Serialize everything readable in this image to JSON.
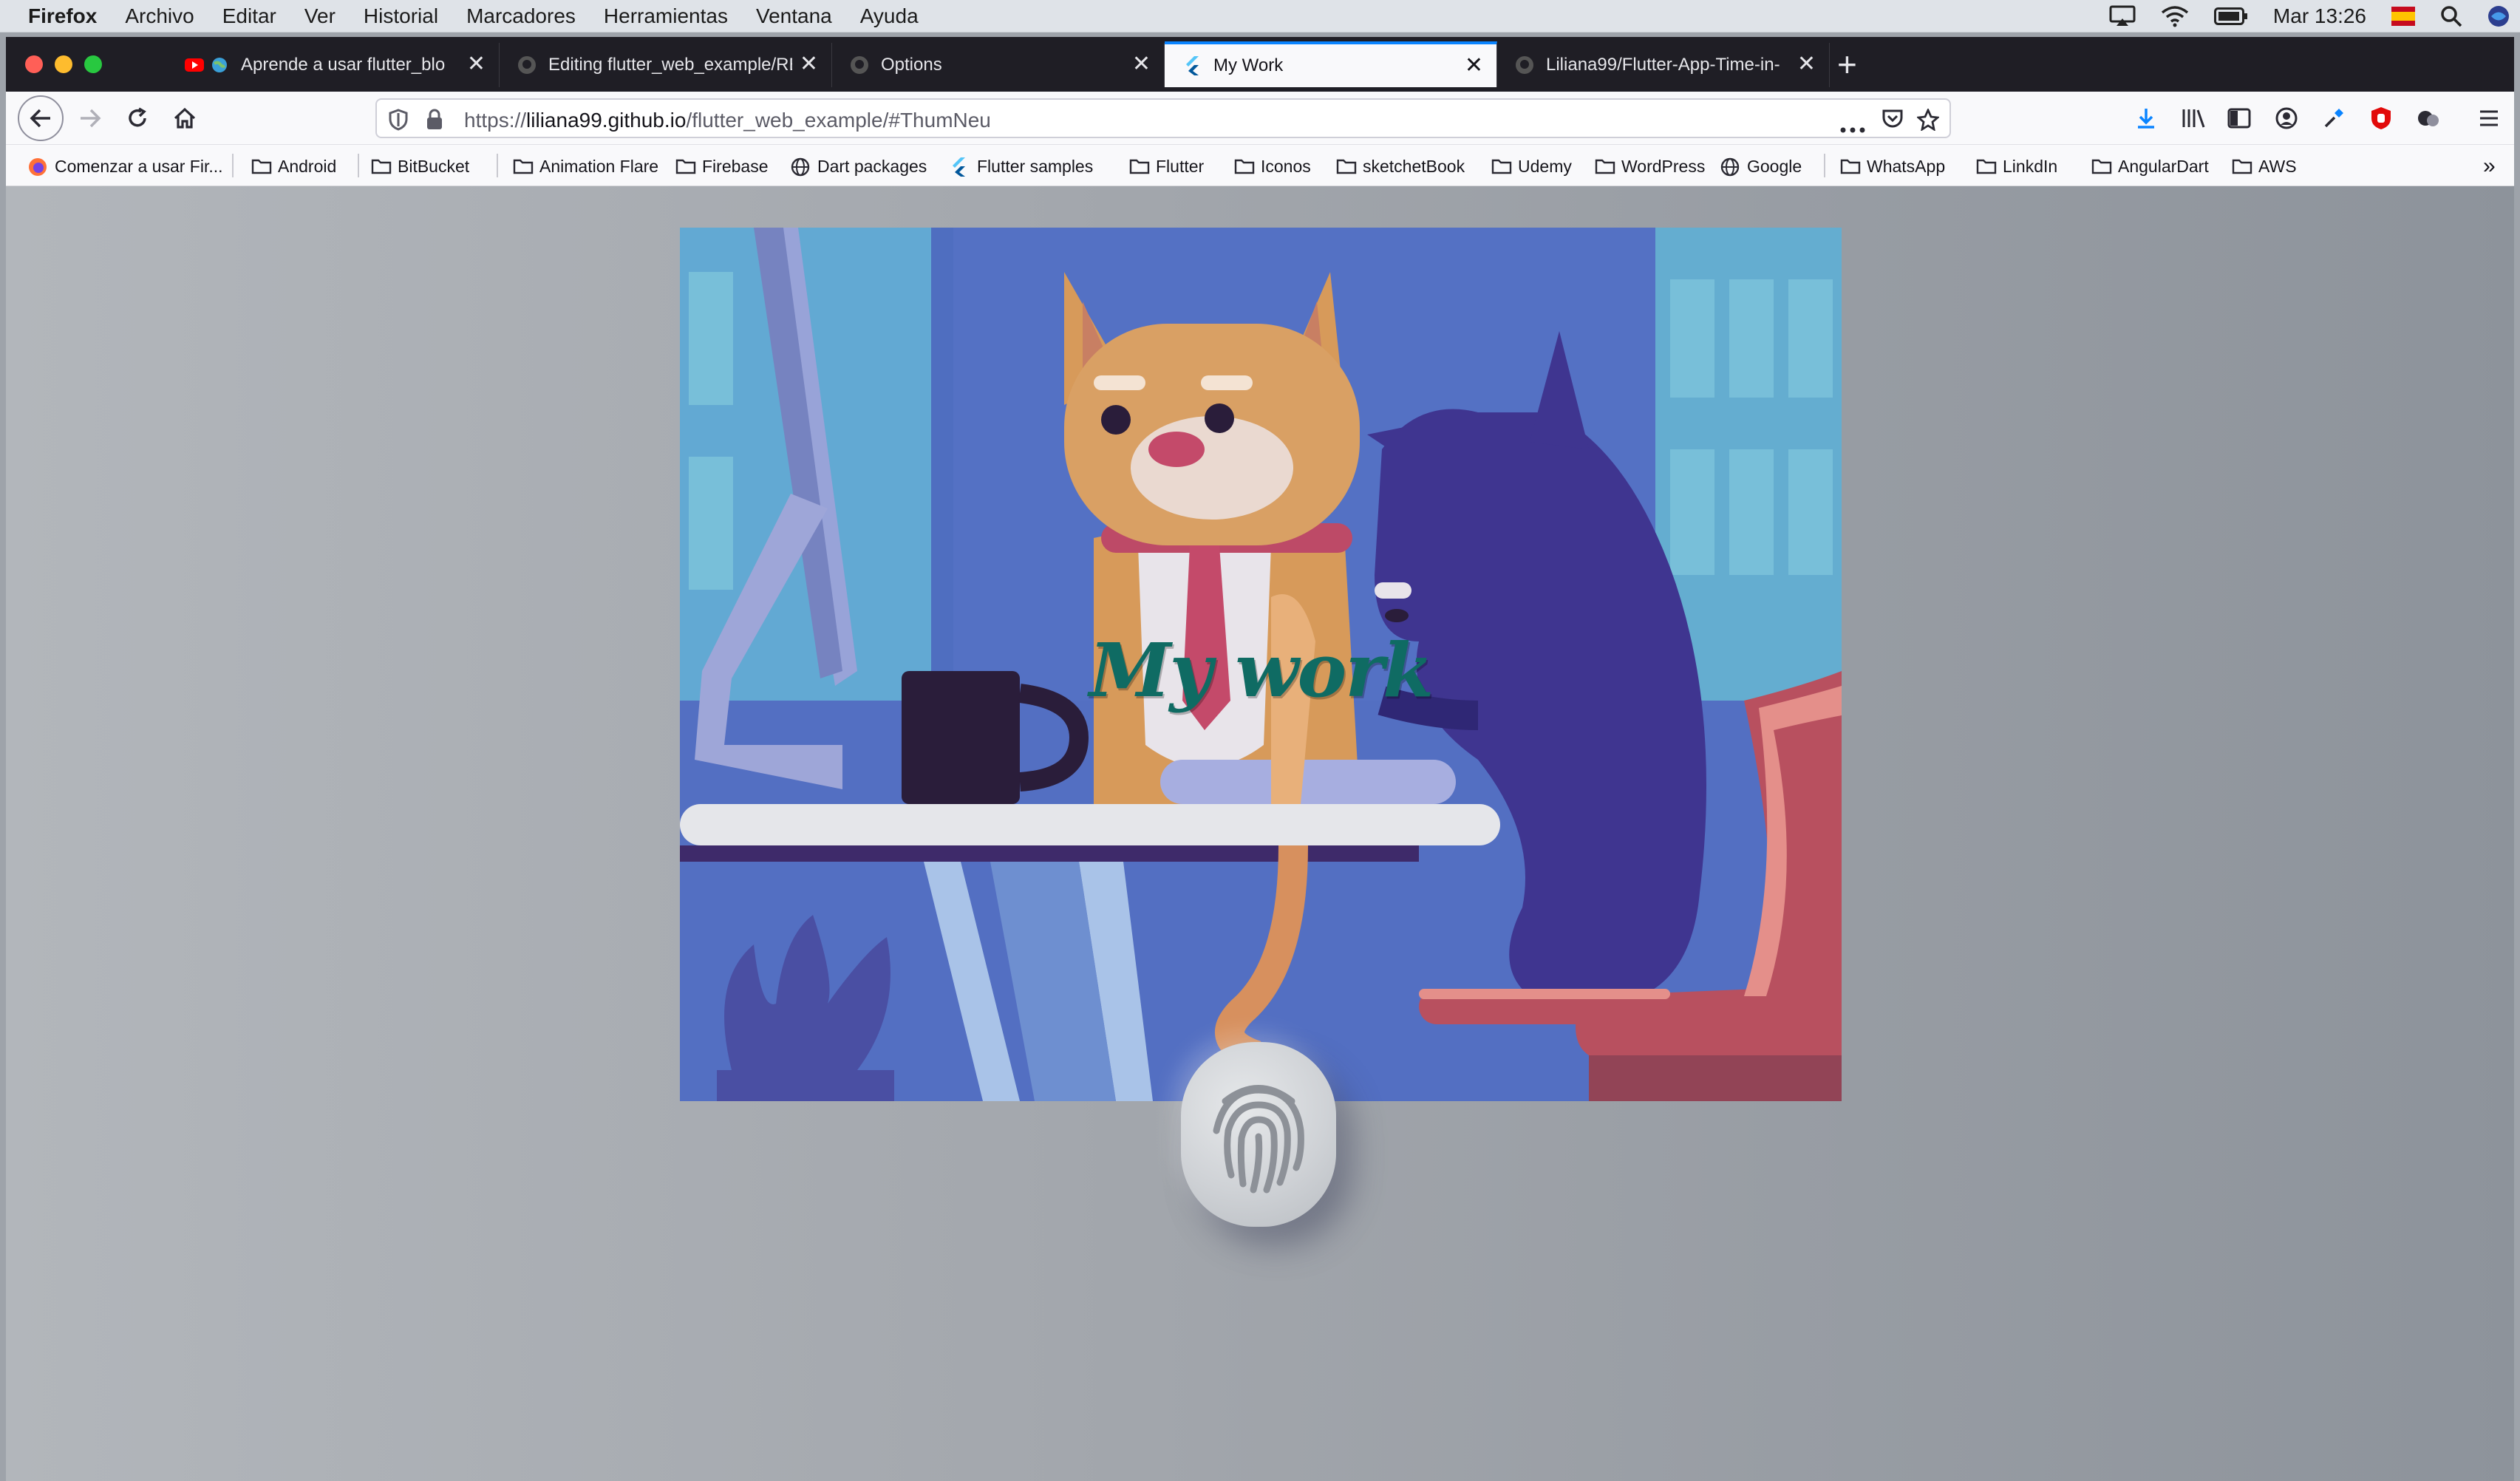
{
  "menubar": {
    "app": "Firefox",
    "items": [
      "Archivo",
      "Editar",
      "Ver",
      "Historial",
      "Marcadores",
      "Herramientas",
      "Ventana",
      "Ayuda"
    ],
    "clock": "Mar 13:26"
  },
  "tabs": [
    {
      "label": "Aprende a usar flutter_blo",
      "icon": "youtube-icon"
    },
    {
      "label": "Editing flutter_web_example/RE",
      "icon": "github-icon"
    },
    {
      "label": "Options",
      "icon": "github-icon"
    },
    {
      "label": "My Work",
      "icon": "flutter-icon",
      "active": true
    },
    {
      "label": "Liliana99/Flutter-App-Time-in-",
      "icon": "github-icon"
    }
  ],
  "urlbar": {
    "prefix": "https://",
    "host": "liliana99.github.io",
    "path": "/flutter_web_example/#ThumNeu"
  },
  "bookmarks": [
    {
      "label": "Comenzar a usar Fir...",
      "icon": "firefox-icon"
    },
    {
      "label": "Android",
      "icon": "folder-icon"
    },
    {
      "label": "BitBucket",
      "icon": "folder-icon"
    },
    {
      "label": "Animation Flare",
      "icon": "folder-icon"
    },
    {
      "label": "Firebase",
      "icon": "folder-icon"
    },
    {
      "label": "Dart packages",
      "icon": "globe-icon"
    },
    {
      "label": "Flutter samples",
      "icon": "flutter-icon"
    },
    {
      "label": "Flutter",
      "icon": "folder-icon"
    },
    {
      "label": "Iconos",
      "icon": "folder-icon"
    },
    {
      "label": "sketchetBook",
      "icon": "folder-icon"
    },
    {
      "label": "Udemy",
      "icon": "folder-icon"
    },
    {
      "label": "WordPress",
      "icon": "folder-icon"
    },
    {
      "label": "Google",
      "icon": "globe-icon"
    },
    {
      "label": "WhatsApp",
      "icon": "folder-icon"
    },
    {
      "label": "LinkdIn",
      "icon": "folder-icon"
    },
    {
      "label": "AngularDart",
      "icon": "folder-icon"
    },
    {
      "label": "AWS",
      "icon": "folder-icon"
    }
  ],
  "page": {
    "title": "My work"
  },
  "colors": {
    "title": "#0f6b63",
    "accent": "#0a84ff",
    "tabstrip": "#1f1e25"
  }
}
